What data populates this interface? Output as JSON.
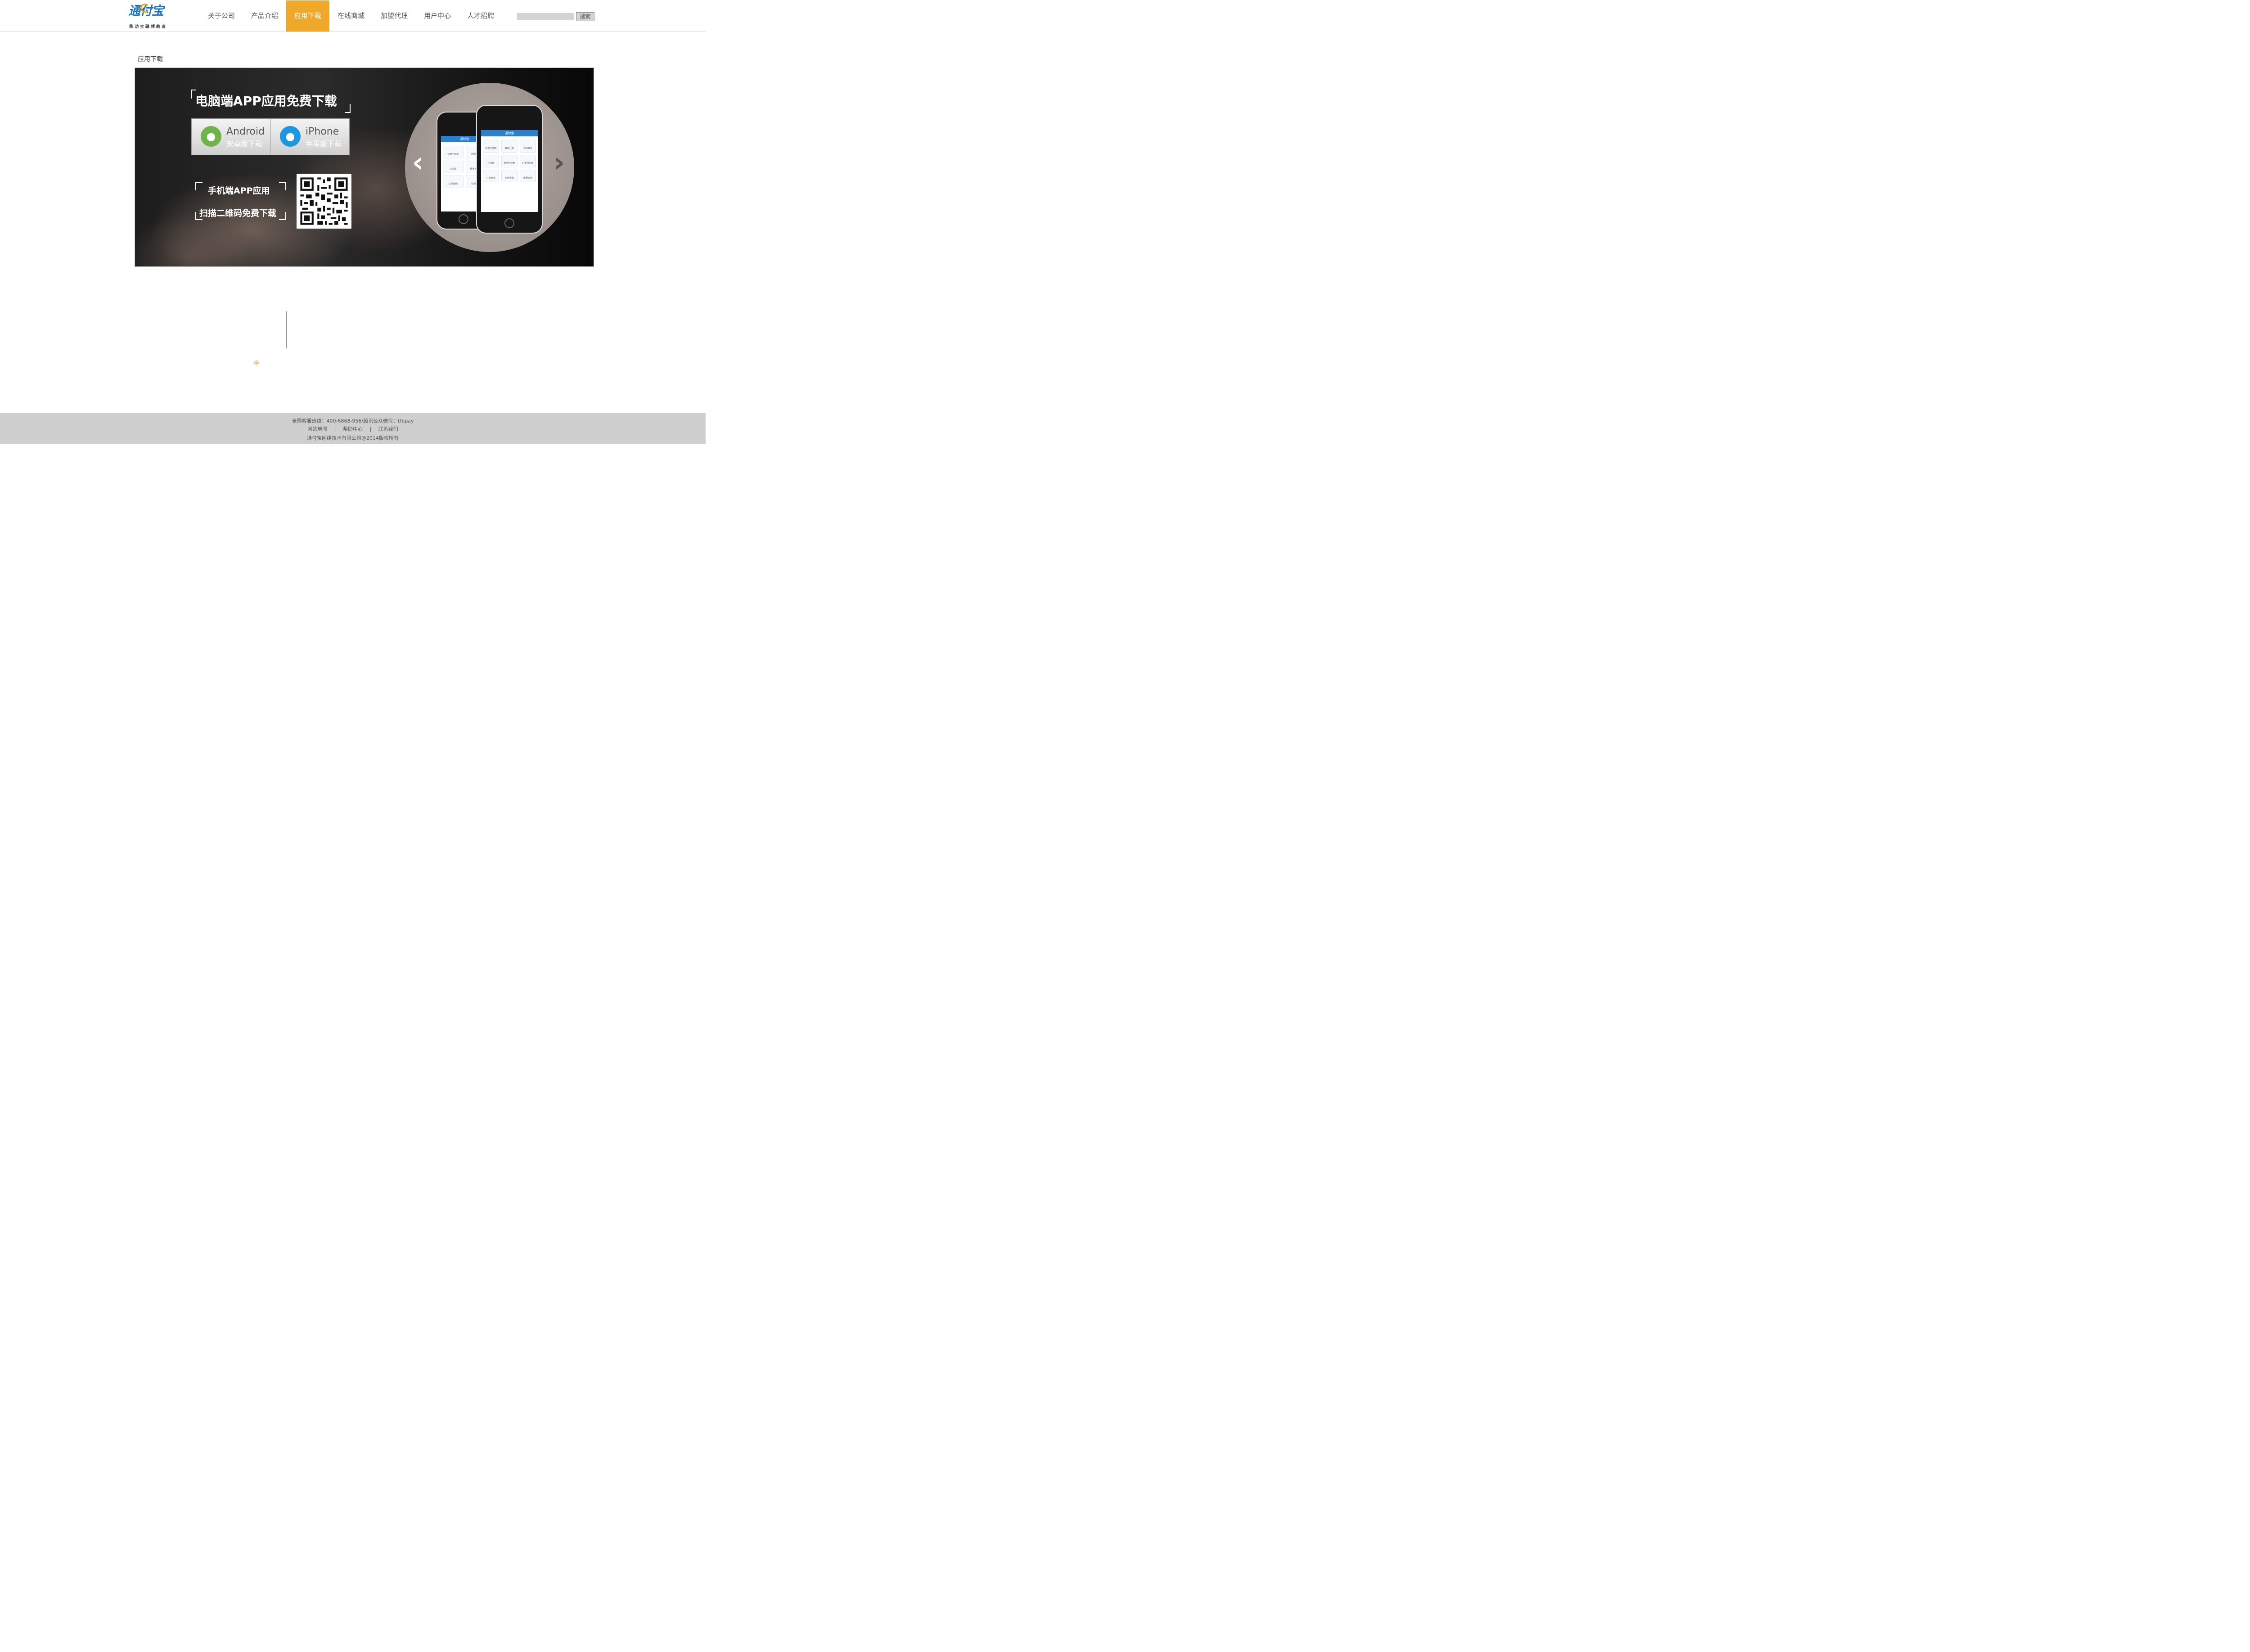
{
  "header": {
    "logo_text": "通付宝",
    "logo_slogan": "移动金融领航者",
    "nav": [
      "关于公司",
      "产品介绍",
      "应用下载",
      "在线商城",
      "加盟代理",
      "用户中心",
      "人才招聘"
    ],
    "active_nav": "应用下载",
    "search_placeholder": "",
    "search_button": "搜索"
  },
  "page": {
    "title": "应用下载"
  },
  "banner": {
    "heading": "电脑端APP应用免费下载",
    "android": {
      "title": "Android",
      "subtitle": "安卓版下载"
    },
    "iphone": {
      "title": "iPhone",
      "subtitle": "苹果版下载"
    },
    "mobile_line1": "手机端APP应用",
    "mobile_line2": "扫描二维码免费下载",
    "phone_app_title": "通付宝",
    "phone_tiles": [
      "信用卡还款",
      "转账汇款",
      "我的钱包",
      "还贷款",
      "现金抵用券",
      "订单号付款",
      "订单查询",
      "快递查询",
      "余额查询"
    ],
    "arrow_left": "‹",
    "arrow_right": "›"
  },
  "footer": {
    "hotline": "全国客服热线：400-6868-956/腾讯公众微信：tfbpay",
    "links": [
      "网站地图",
      "帮助中心",
      "联系我们"
    ],
    "separator": "|",
    "copyright": "通付宝网络技术有限公司@2014版权所有"
  },
  "colors": {
    "accent": "#f0a82a",
    "brand_blue": "#1e73be",
    "footer_bg": "#cfcfcf"
  }
}
